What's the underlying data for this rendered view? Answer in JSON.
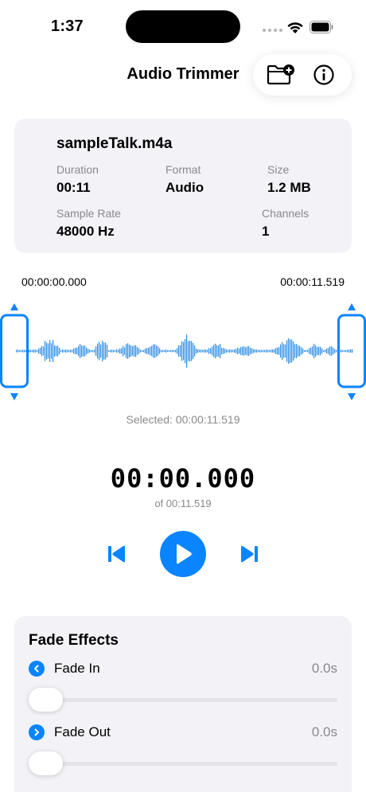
{
  "status": {
    "time": "1:37"
  },
  "nav": {
    "title": "Audio Trimmer",
    "add_icon": "folder-add-icon",
    "info_icon": "info-icon"
  },
  "file": {
    "name": "sampleTalk.m4a",
    "duration_label": "Duration",
    "duration": "00:11",
    "format_label": "Format",
    "format": "Audio",
    "size_label": "Size",
    "size": "1.2 MB",
    "sample_rate_label": "Sample Rate",
    "sample_rate": "48000 Hz",
    "channels_label": "Channels",
    "channels": "1"
  },
  "waveform": {
    "start_time": "00:00:00.000",
    "end_time": "00:00:11.519",
    "selected_text": "Selected: 00:00:11.519",
    "color": "#2a8ce6",
    "selection_start": 0.0,
    "selection_end": 1.0
  },
  "playback": {
    "current_time": "00:00.000",
    "total_text": "of 00:11.519",
    "accent": "#0a84ff"
  },
  "fade": {
    "title": "Fade Effects",
    "fade_in": {
      "label": "Fade In",
      "value": "0.0s",
      "level": 0
    },
    "fade_out": {
      "label": "Fade Out",
      "value": "0.0s",
      "level": 0
    }
  }
}
